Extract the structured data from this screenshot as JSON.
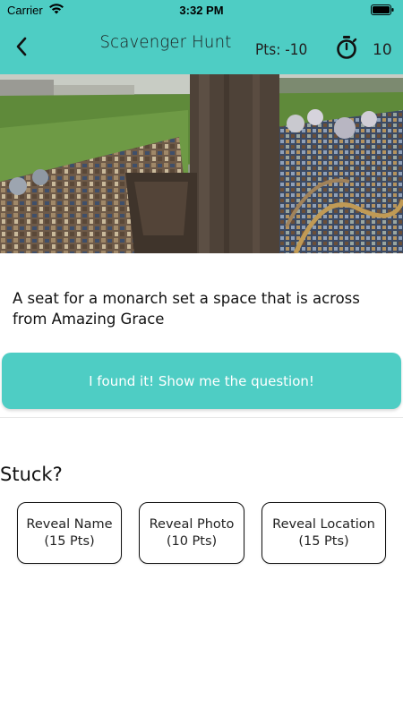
{
  "status_bar": {
    "carrier": "Carrier",
    "time": "3:32 PM",
    "wifi_icon": "wifi-icon",
    "battery_icon": "battery-icon"
  },
  "header": {
    "title": "Scavenger Hunt",
    "points": "Pts: -10",
    "timer_icon": "stopwatch-icon",
    "timer_value": "10",
    "back_icon": "chevron-left-icon",
    "color": "#4ecdc4"
  },
  "clue": {
    "text": "A seat for a monarch set a space that is across from Amazing Grace"
  },
  "found_button": {
    "label": "I found it! Show me the question!"
  },
  "stuck": {
    "heading": "Stuck?",
    "hints": [
      {
        "line1": "Reveal Name",
        "line2": "(15 Pts)"
      },
      {
        "line1": "Reveal Photo",
        "line2": "(10 Pts)"
      },
      {
        "line1": "Reveal Location",
        "line2": "(15 Pts)"
      }
    ]
  }
}
